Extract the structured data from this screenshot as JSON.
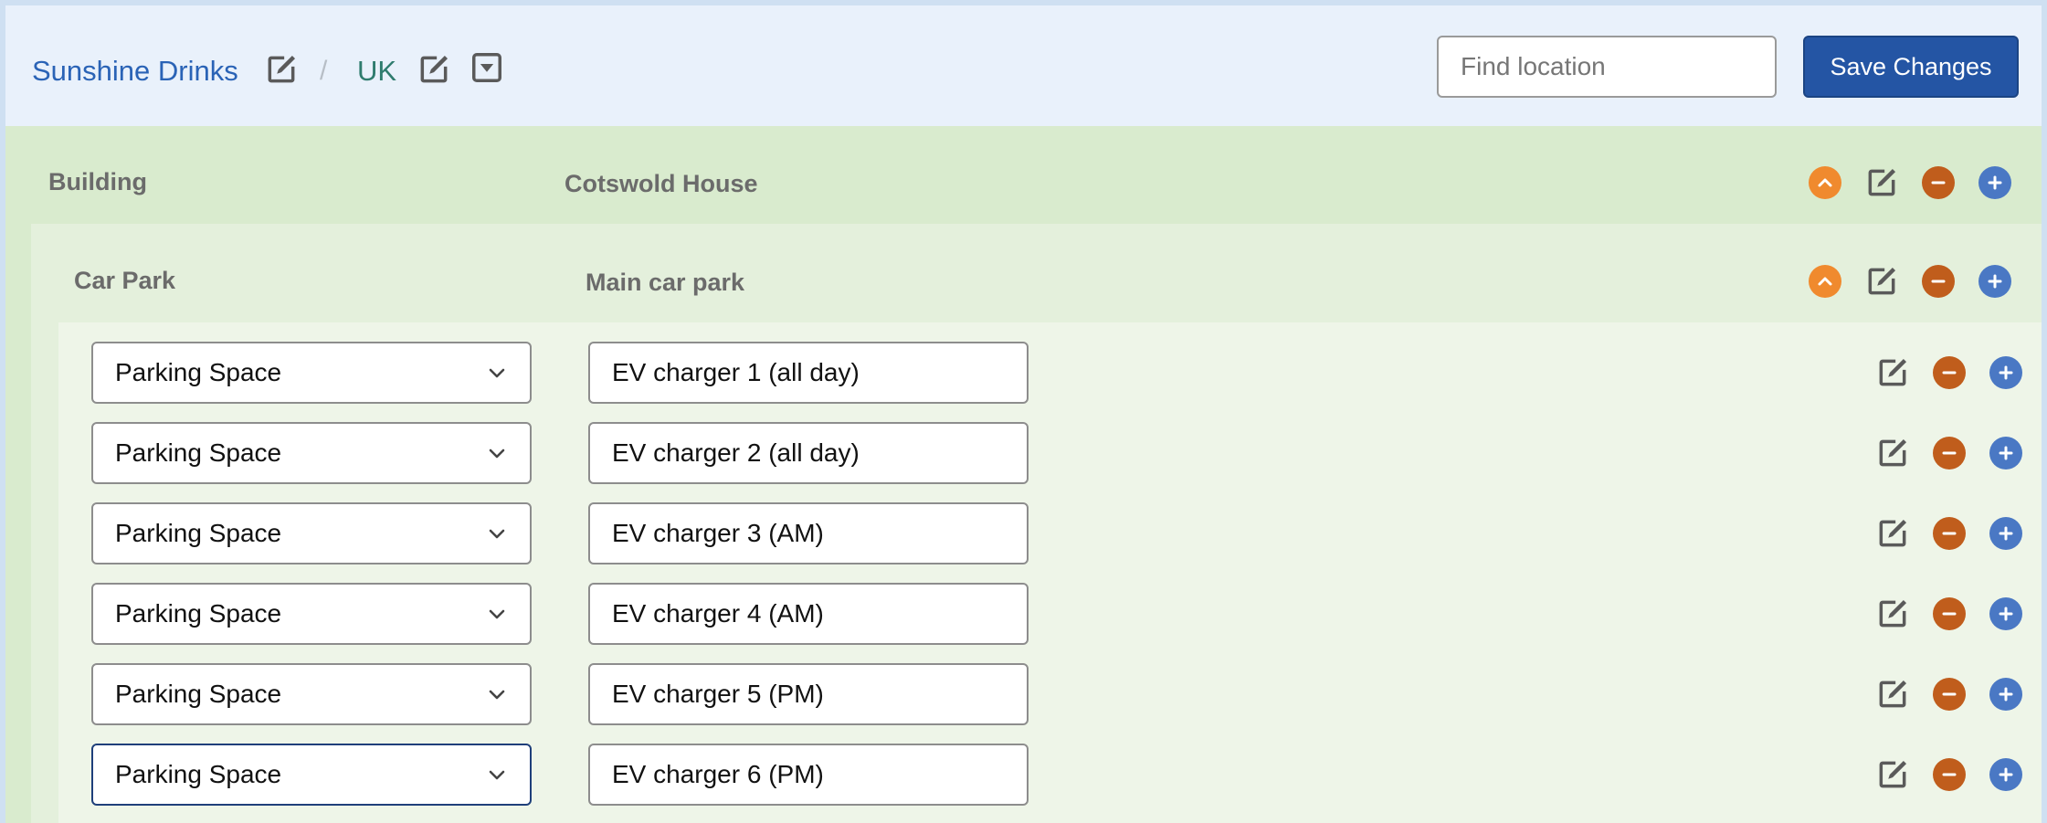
{
  "header": {
    "org_name": "Sunshine Drinks",
    "separator": "/",
    "region_name": "UK",
    "search_placeholder": "Find location",
    "save_label": "Save Changes"
  },
  "building": {
    "type_label": "Building",
    "name": "Cotswold House"
  },
  "car_park": {
    "type_label": "Car Park",
    "name": "Main car park"
  },
  "spaces": [
    {
      "type": "Parking Space",
      "name": "EV charger 1 (all day)"
    },
    {
      "type": "Parking Space",
      "name": "EV charger 2 (all day)"
    },
    {
      "type": "Parking Space",
      "name": "EV charger 3 (AM)"
    },
    {
      "type": "Parking Space",
      "name": "EV charger 4 (AM)"
    },
    {
      "type": "Parking Space",
      "name": "EV charger 5 (PM)"
    },
    {
      "type": "Parking Space",
      "name": "EV charger 6 (PM)"
    }
  ],
  "icons": {
    "edit": "edit-icon",
    "dropdown": "dropdown-square-icon",
    "collapse": "chevron-up-circle-icon",
    "remove": "minus-circle-icon",
    "add": "plus-circle-icon",
    "select_arrow": "chevron-down-icon"
  },
  "colors": {
    "primary": "#2455a4",
    "link": "#2a63b6",
    "region_link": "#2f7c6e",
    "collapse": "#f08a2e",
    "remove": "#c05d1c",
    "add": "#4a78c4",
    "level1_bg": "#d9ebce",
    "level2_bg": "#e4f0dc",
    "level3_bg": "#eef5e8"
  }
}
